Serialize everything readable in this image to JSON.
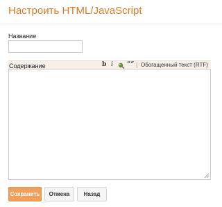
{
  "dialog": {
    "title": "Настроить HTML/JavaScript",
    "accent_color": "#dd7a1f"
  },
  "form": {
    "name_label": "Название",
    "name_value": "",
    "content_label": "Содержание",
    "content_value": ""
  },
  "toolbar": {
    "bold_label": "b",
    "italic_label": "i",
    "link_icon": "link-icon",
    "quote_label": "““",
    "divider": "|",
    "rtf_label": "Обогащенный текст (RTF)"
  },
  "buttons": {
    "save_label": "Сохранить",
    "cancel_label": "Отмена",
    "back_label": "Назад",
    "save_color": "#f0a05c"
  }
}
